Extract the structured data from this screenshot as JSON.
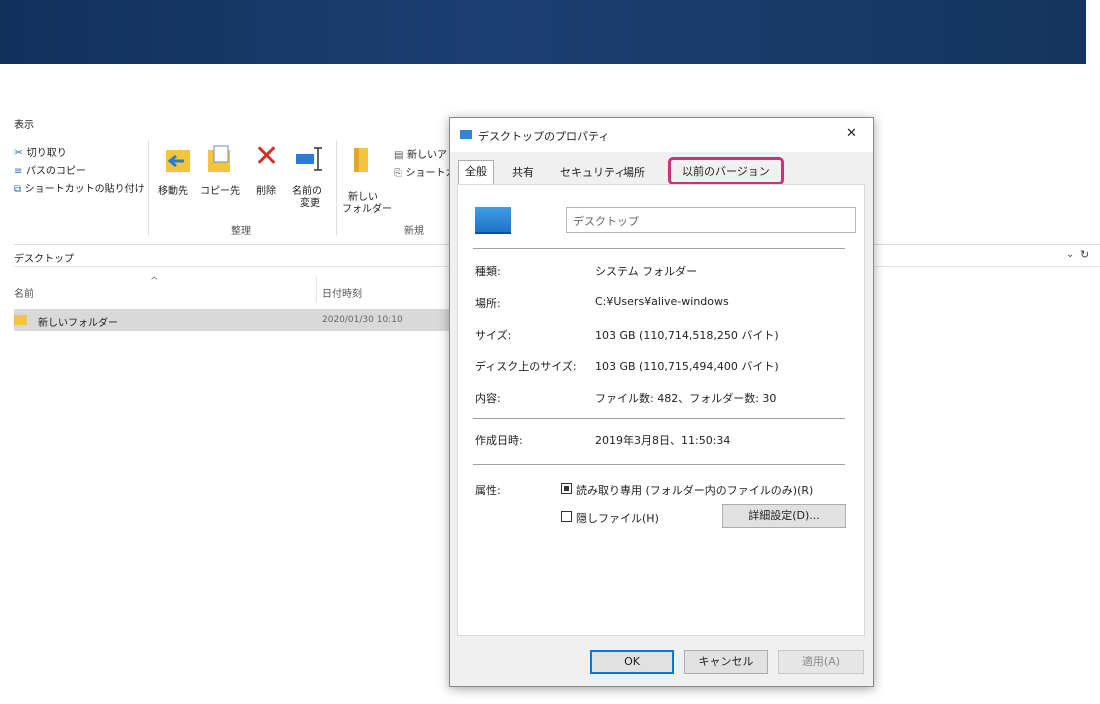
{
  "explorer": {
    "tab_view": "表示",
    "ribbon": {
      "clipboard": {
        "cut": "切り取り",
        "copy_path": "パスのコピー",
        "paste_shortcut": "ショートカットの貼り付け"
      },
      "organize": {
        "move_to": "移動先",
        "copy_to": "コピー先",
        "delete": "削除",
        "rename_line1": "名前の",
        "rename_line2": "変更",
        "group": "整理"
      },
      "new": {
        "new_folder_line1": "新しい",
        "new_folder_line2": "フォルダー",
        "new_item": "新しいア",
        "shortcut": "ショートカ",
        "group": "新規"
      }
    },
    "address": "デスクトップ",
    "columns": {
      "name": "名前",
      "date": "日付時刻"
    },
    "files": [
      {
        "name": "新しいフォルダー",
        "date": "2020/01/30 10:10"
      }
    ]
  },
  "dialog": {
    "title": "デスクトップのプロパティ",
    "tabs": [
      "全般",
      "共有",
      "セキュリティ",
      "場所",
      "以前のバージョン"
    ],
    "name_value": "デスクトップ",
    "props": [
      {
        "label": "種類:",
        "value": "システム フォルダー"
      },
      {
        "label": "場所:",
        "value": "C:¥Users¥alive-windows"
      },
      {
        "label": "サイズ:",
        "value": "103 GB (110,714,518,250 バイト)"
      },
      {
        "label": "ディスク上のサイズ:",
        "value": "103 GB (110,715,494,400 バイト)"
      },
      {
        "label": "内容:",
        "value": "ファイル数: 482、フォルダー数: 30"
      }
    ],
    "created_label": "作成日時:",
    "created_value": "2019年3月8日、11:50:34",
    "attr_label": "属性:",
    "readonly_label": "読み取り専用 (フォルダー内のファイルのみ)(R)",
    "hidden_label": "隠しファイル(H)",
    "advanced_button": "詳細設定(D)...",
    "ok": "OK",
    "cancel": "キャンセル",
    "apply": "適用(A)",
    "close": "✕"
  },
  "colors": {
    "highlight": "#c8337a",
    "banner": "#17386a"
  }
}
